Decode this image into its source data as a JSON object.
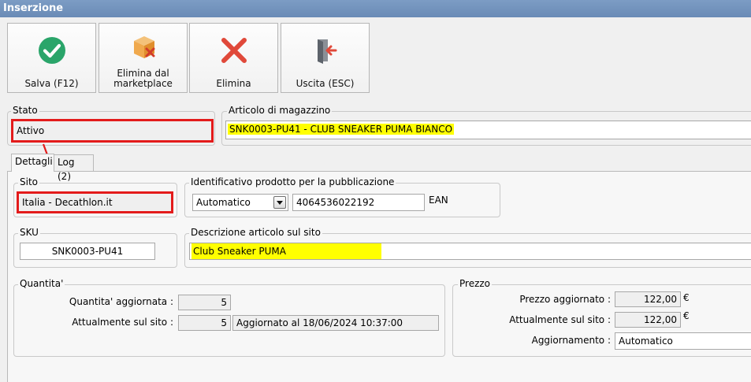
{
  "window": {
    "title": "Inserzione"
  },
  "toolbar": {
    "save_label": "Salva (F12)",
    "remove_marketplace_label_line1": "Elimina dal",
    "remove_marketplace_label_line2": "marketplace",
    "delete_label": "Elimina",
    "exit_label": "Uscita (ESC)"
  },
  "stato": {
    "title": "Stato",
    "value": "Attivo"
  },
  "articolo": {
    "title": "Articolo di magazzino",
    "value": "SNK0003-PU41 - CLUB SNEAKER PUMA BIANCO"
  },
  "tabs": [
    {
      "label": "Dettagli"
    },
    {
      "label": "Log (2)"
    }
  ],
  "sito": {
    "title": "Sito",
    "value": "Italia - Decathlon.it"
  },
  "identificativo": {
    "title": "Identificativo prodotto per la pubblicazione",
    "mode_value": "Automatico",
    "code_value": "4064536022192",
    "code_type": "EAN"
  },
  "sku": {
    "title": "SKU",
    "value": "SNK0003-PU41"
  },
  "descrizione": {
    "title": "Descrizione articolo sul sito",
    "value": "Club Sneaker PUMA"
  },
  "quantita": {
    "title": "Quantita'",
    "updated_label": "Quantita' aggiornata :",
    "updated_value": "5",
    "current_label": "Attualmente sul sito :",
    "current_value": "5",
    "current_note": "Aggiornato al 18/06/2024 10:37:00"
  },
  "prezzo": {
    "title": "Prezzo",
    "updated_label": "Prezzo aggiornato :",
    "updated_value": "122,00",
    "current_label": "Attualmente sul sito :",
    "current_value": "122,00",
    "currency": "€",
    "aggiornamento_label": "Aggiornamento :",
    "aggiornamento_value": "Automatico"
  },
  "colors": {
    "highlight": "#ffff00",
    "annotation_red": "#e31b1b",
    "title_bar": "#6f8fb9"
  }
}
